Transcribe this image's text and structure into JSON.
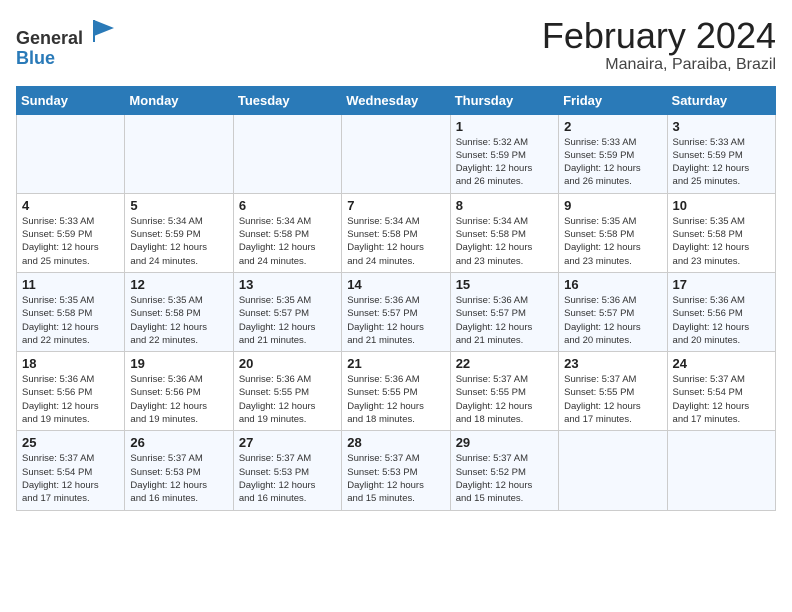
{
  "header": {
    "logo_general": "General",
    "logo_blue": "Blue",
    "title": "February 2024",
    "subtitle": "Manaira, Paraiba, Brazil"
  },
  "weekdays": [
    "Sunday",
    "Monday",
    "Tuesday",
    "Wednesday",
    "Thursday",
    "Friday",
    "Saturday"
  ],
  "weeks": [
    [
      {
        "day": "",
        "info": ""
      },
      {
        "day": "",
        "info": ""
      },
      {
        "day": "",
        "info": ""
      },
      {
        "day": "",
        "info": ""
      },
      {
        "day": "1",
        "info": "Sunrise: 5:32 AM\nSunset: 5:59 PM\nDaylight: 12 hours\nand 26 minutes."
      },
      {
        "day": "2",
        "info": "Sunrise: 5:33 AM\nSunset: 5:59 PM\nDaylight: 12 hours\nand 26 minutes."
      },
      {
        "day": "3",
        "info": "Sunrise: 5:33 AM\nSunset: 5:59 PM\nDaylight: 12 hours\nand 25 minutes."
      }
    ],
    [
      {
        "day": "4",
        "info": "Sunrise: 5:33 AM\nSunset: 5:59 PM\nDaylight: 12 hours\nand 25 minutes."
      },
      {
        "day": "5",
        "info": "Sunrise: 5:34 AM\nSunset: 5:59 PM\nDaylight: 12 hours\nand 24 minutes."
      },
      {
        "day": "6",
        "info": "Sunrise: 5:34 AM\nSunset: 5:58 PM\nDaylight: 12 hours\nand 24 minutes."
      },
      {
        "day": "7",
        "info": "Sunrise: 5:34 AM\nSunset: 5:58 PM\nDaylight: 12 hours\nand 24 minutes."
      },
      {
        "day": "8",
        "info": "Sunrise: 5:34 AM\nSunset: 5:58 PM\nDaylight: 12 hours\nand 23 minutes."
      },
      {
        "day": "9",
        "info": "Sunrise: 5:35 AM\nSunset: 5:58 PM\nDaylight: 12 hours\nand 23 minutes."
      },
      {
        "day": "10",
        "info": "Sunrise: 5:35 AM\nSunset: 5:58 PM\nDaylight: 12 hours\nand 23 minutes."
      }
    ],
    [
      {
        "day": "11",
        "info": "Sunrise: 5:35 AM\nSunset: 5:58 PM\nDaylight: 12 hours\nand 22 minutes."
      },
      {
        "day": "12",
        "info": "Sunrise: 5:35 AM\nSunset: 5:58 PM\nDaylight: 12 hours\nand 22 minutes."
      },
      {
        "day": "13",
        "info": "Sunrise: 5:35 AM\nSunset: 5:57 PM\nDaylight: 12 hours\nand 21 minutes."
      },
      {
        "day": "14",
        "info": "Sunrise: 5:36 AM\nSunset: 5:57 PM\nDaylight: 12 hours\nand 21 minutes."
      },
      {
        "day": "15",
        "info": "Sunrise: 5:36 AM\nSunset: 5:57 PM\nDaylight: 12 hours\nand 21 minutes."
      },
      {
        "day": "16",
        "info": "Sunrise: 5:36 AM\nSunset: 5:57 PM\nDaylight: 12 hours\nand 20 minutes."
      },
      {
        "day": "17",
        "info": "Sunrise: 5:36 AM\nSunset: 5:56 PM\nDaylight: 12 hours\nand 20 minutes."
      }
    ],
    [
      {
        "day": "18",
        "info": "Sunrise: 5:36 AM\nSunset: 5:56 PM\nDaylight: 12 hours\nand 19 minutes."
      },
      {
        "day": "19",
        "info": "Sunrise: 5:36 AM\nSunset: 5:56 PM\nDaylight: 12 hours\nand 19 minutes."
      },
      {
        "day": "20",
        "info": "Sunrise: 5:36 AM\nSunset: 5:55 PM\nDaylight: 12 hours\nand 19 minutes."
      },
      {
        "day": "21",
        "info": "Sunrise: 5:36 AM\nSunset: 5:55 PM\nDaylight: 12 hours\nand 18 minutes."
      },
      {
        "day": "22",
        "info": "Sunrise: 5:37 AM\nSunset: 5:55 PM\nDaylight: 12 hours\nand 18 minutes."
      },
      {
        "day": "23",
        "info": "Sunrise: 5:37 AM\nSunset: 5:55 PM\nDaylight: 12 hours\nand 17 minutes."
      },
      {
        "day": "24",
        "info": "Sunrise: 5:37 AM\nSunset: 5:54 PM\nDaylight: 12 hours\nand 17 minutes."
      }
    ],
    [
      {
        "day": "25",
        "info": "Sunrise: 5:37 AM\nSunset: 5:54 PM\nDaylight: 12 hours\nand 17 minutes."
      },
      {
        "day": "26",
        "info": "Sunrise: 5:37 AM\nSunset: 5:53 PM\nDaylight: 12 hours\nand 16 minutes."
      },
      {
        "day": "27",
        "info": "Sunrise: 5:37 AM\nSunset: 5:53 PM\nDaylight: 12 hours\nand 16 minutes."
      },
      {
        "day": "28",
        "info": "Sunrise: 5:37 AM\nSunset: 5:53 PM\nDaylight: 12 hours\nand 15 minutes."
      },
      {
        "day": "29",
        "info": "Sunrise: 5:37 AM\nSunset: 5:52 PM\nDaylight: 12 hours\nand 15 minutes."
      },
      {
        "day": "",
        "info": ""
      },
      {
        "day": "",
        "info": ""
      }
    ]
  ]
}
